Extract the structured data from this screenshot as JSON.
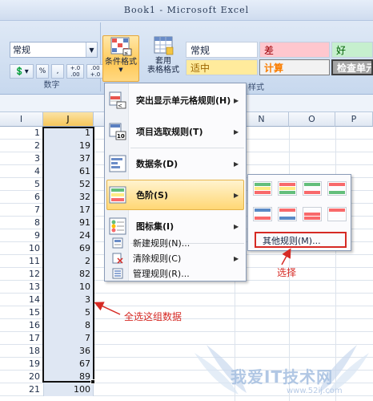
{
  "window": {
    "title": "Book1 - Microsoft Excel"
  },
  "ribbon": {
    "number_format_value": "常规",
    "number_group_label": "数字",
    "num_buttons": [
      "%",
      ",",
      "+.0 .00",
      ".00 +.0"
    ],
    "conditional_format_label": "条件格式",
    "table_format_label": "套用\n表格格式",
    "styles_group_label": "样式",
    "styles": [
      {
        "label": "常规",
        "bg": "#ffffff",
        "color": "#000000"
      },
      {
        "label": "差",
        "bg": "#ffc7ce",
        "color": "#9c0006"
      },
      {
        "label": "好",
        "bg": "#c6efce",
        "color": "#006100"
      },
      {
        "label": "适中",
        "bg": "#ffeb9c",
        "color": "#9c6500"
      },
      {
        "label": "计算",
        "bg": "#f2f2f2",
        "color": "#fa7d00"
      },
      {
        "label": "检查单元",
        "bg": "#a5a5a5",
        "color": "#ffffff"
      }
    ]
  },
  "columns": [
    "I",
    "J",
    "N",
    "O",
    "P"
  ],
  "rows": [
    {
      "n": "1",
      "v": "1"
    },
    {
      "n": "2",
      "v": "19"
    },
    {
      "n": "3",
      "v": "37"
    },
    {
      "n": "4",
      "v": "61"
    },
    {
      "n": "5",
      "v": "52"
    },
    {
      "n": "6",
      "v": "32"
    },
    {
      "n": "7",
      "v": "17"
    },
    {
      "n": "8",
      "v": "91"
    },
    {
      "n": "9",
      "v": "24"
    },
    {
      "n": "10",
      "v": "69"
    },
    {
      "n": "11",
      "v": "2"
    },
    {
      "n": "12",
      "v": "82"
    },
    {
      "n": "13",
      "v": "10"
    },
    {
      "n": "14",
      "v": "3"
    },
    {
      "n": "15",
      "v": "5"
    },
    {
      "n": "16",
      "v": "8"
    },
    {
      "n": "17",
      "v": "7"
    },
    {
      "n": "18",
      "v": "36"
    },
    {
      "n": "19",
      "v": "67"
    },
    {
      "n": "20",
      "v": "89"
    },
    {
      "n": "21",
      "v": "100"
    }
  ],
  "menu": {
    "items": [
      {
        "label": "突出显示单元格规则(H)",
        "icon": "highlight-rules-icon"
      },
      {
        "label": "项目选取规则(T)",
        "icon": "top-bottom-rules-icon"
      },
      {
        "label": "数据条(D)",
        "icon": "data-bars-icon"
      },
      {
        "label": "色阶(S)",
        "icon": "color-scales-icon"
      },
      {
        "label": "图标集(I)",
        "icon": "icon-sets-icon"
      }
    ],
    "small_items": [
      {
        "label": "新建规则(N)...",
        "icon": "new-rule-icon"
      },
      {
        "label": "清除规则(C)",
        "icon": "clear-rules-icon"
      },
      {
        "label": "管理规则(R)...",
        "icon": "manage-rules-icon"
      }
    ]
  },
  "submenu": {
    "more_rules": "其他规则(M)..."
  },
  "annotations": {
    "select_text": "选择",
    "select_all_text": "全选这组数据"
  },
  "watermark": {
    "text": "我爱IT技术网",
    "url": "www.52ij.com"
  },
  "colors": {
    "accent": "#ffc958",
    "annotation_red": "#d62a24"
  }
}
